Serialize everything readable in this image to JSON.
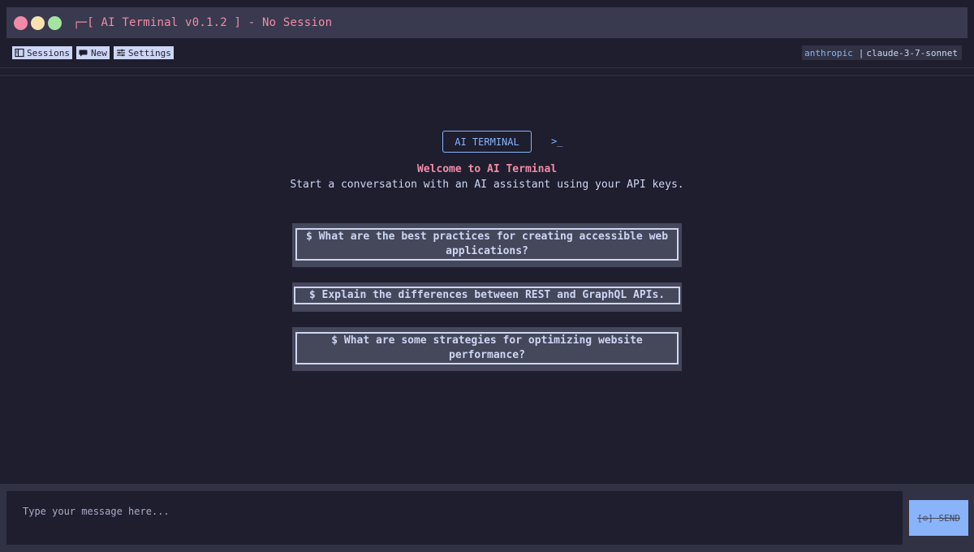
{
  "window": {
    "title": "┌─[ AI Terminal v0.1.2 ] - No Session"
  },
  "toolbar": {
    "sessions_label": "Sessions",
    "new_label": "New",
    "settings_label": "Settings",
    "provider": "anthropic",
    "separator": "|",
    "model": "claude-3-7-sonnet"
  },
  "main": {
    "logo": "AI TERMINAL",
    "prompt_glyph": ">_",
    "welcome": "Welcome to AI Terminal",
    "subtitle": "Start a conversation with an AI assistant using your API keys.",
    "suggestions": [
      "$ What are the best practices for creating accessible web applications?",
      "$ Explain the differences between REST and GraphQL APIs.",
      "$ What are some strategies for optimizing website performance?"
    ]
  },
  "composer": {
    "placeholder": "Type your message here...",
    "send_label": "[⊙] SEND"
  },
  "colors": {
    "background": "#1e1e2e",
    "accent_pink": "#f38ba8",
    "accent_blue": "#89b4fa",
    "panel": "#45475a"
  }
}
